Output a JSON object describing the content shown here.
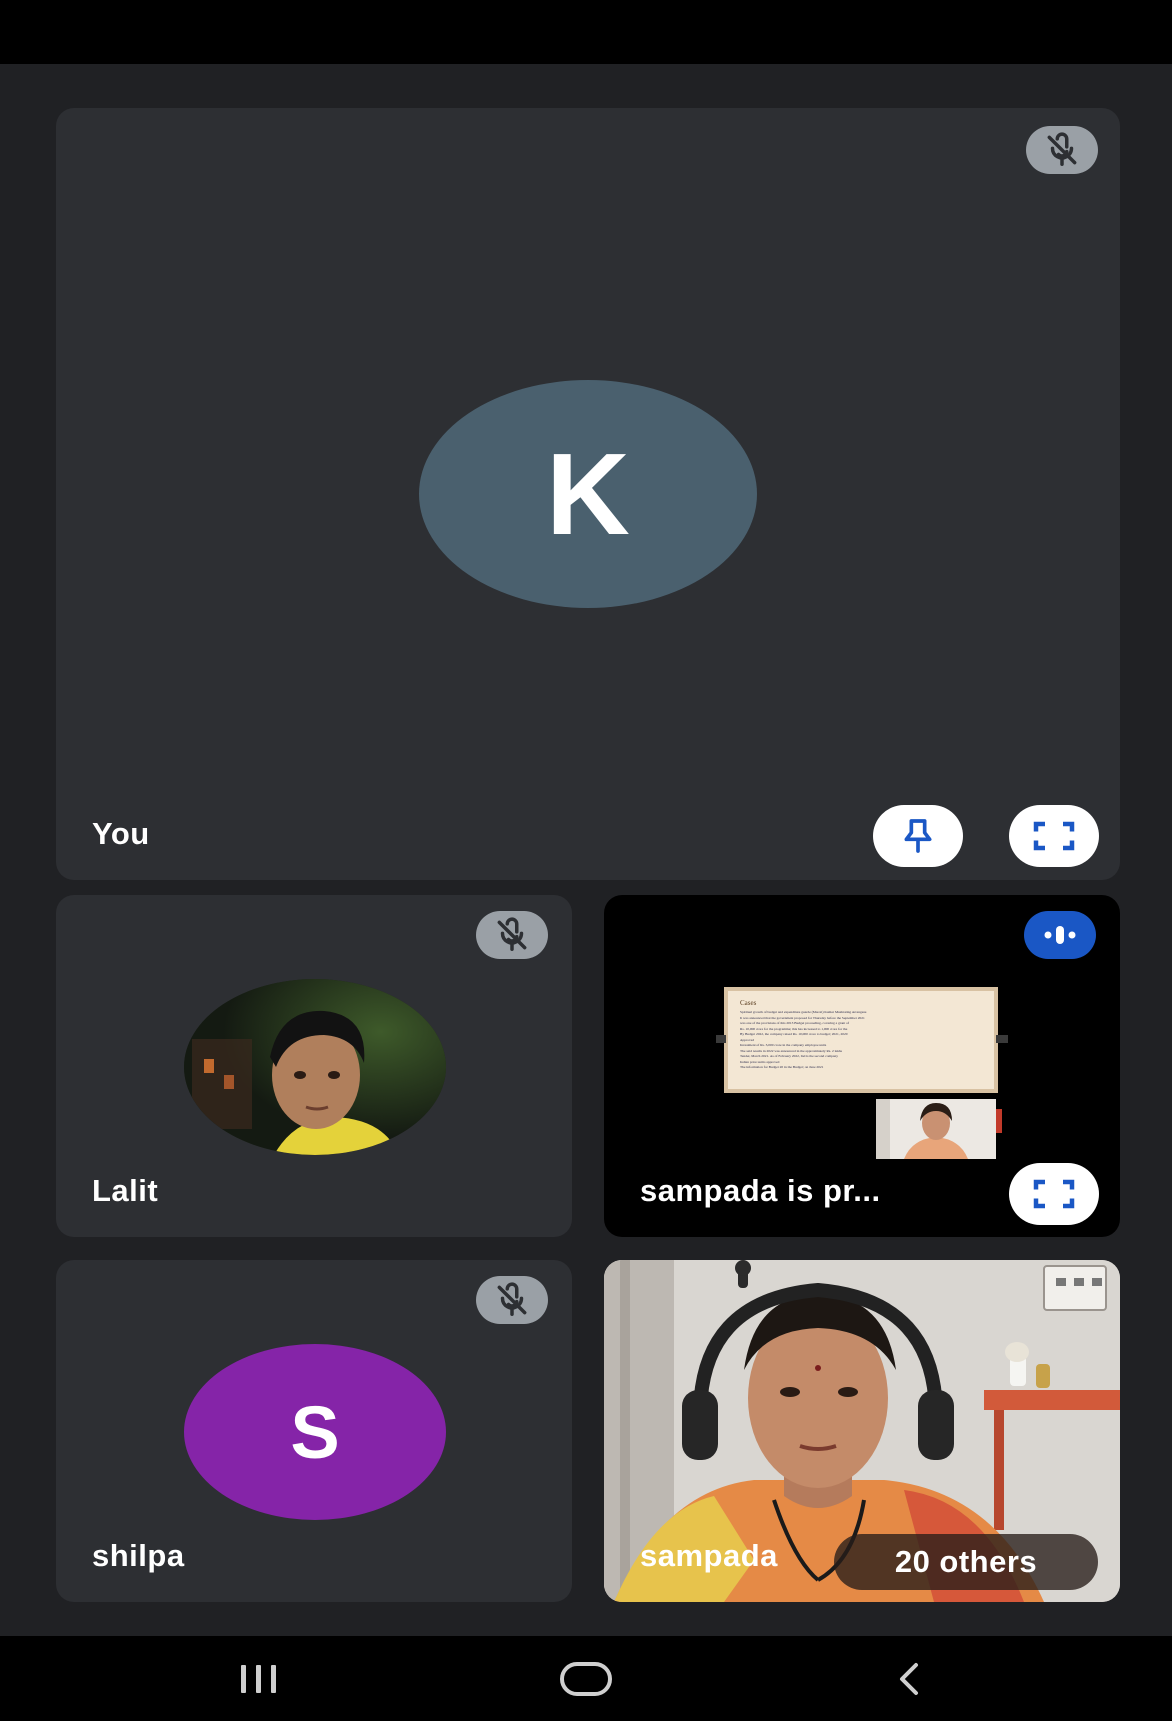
{
  "participants": {
    "self": {
      "name": "You",
      "initial": "K",
      "avatar_color": "#4a606e",
      "muted": true
    },
    "lalit": {
      "name": "Lalit",
      "muted": true
    },
    "presentation": {
      "name": "sampada is pr...",
      "speaking": true,
      "slide_title": "Cases",
      "slide_lines": [
        "Spiritual growth of budget and expenditure guarde (Maroti) Kumar Mushrating Arrangesu",
        "It was announced that the government proposed for Thursday before the September 2021",
        "was one of the provisions of this 2013 Budget proceeding, covering a grant of",
        "Rs. 10,000 crore for the programme; this has increased to 1,000 crore for the",
        "By Budget 2022, the company raised Rs. 10,000 crore to budget; 2021, 2020",
        "Approved",
        "Investment of Rs. 3,000 crore in the company employee units",
        "The said results in 2022 was announced in the approximately Rs. 2 lakhs",
        "Tender, March 2021. As of February 2022, Ind is the second company",
        "Indian price terms approved",
        "The information for Budget 20 in the Budget; on June 2021"
      ]
    },
    "shilpa": {
      "name": "shilpa",
      "initial": "S",
      "avatar_color": "#8524a8",
      "muted": true
    },
    "sampada": {
      "name": "sampada",
      "others_label": "20 others"
    }
  },
  "icons": {
    "mute": "mic-off-icon",
    "pin": "pin-icon",
    "fullscreen": "fullscreen-icon",
    "speaking": "audio-level-icon",
    "nav_recents": "recents-icon",
    "nav_home": "home-icon",
    "nav_back": "back-icon"
  },
  "colors": {
    "background": "#202124",
    "tile": "#2d2f33",
    "accent_blue": "#1a57c5"
  }
}
